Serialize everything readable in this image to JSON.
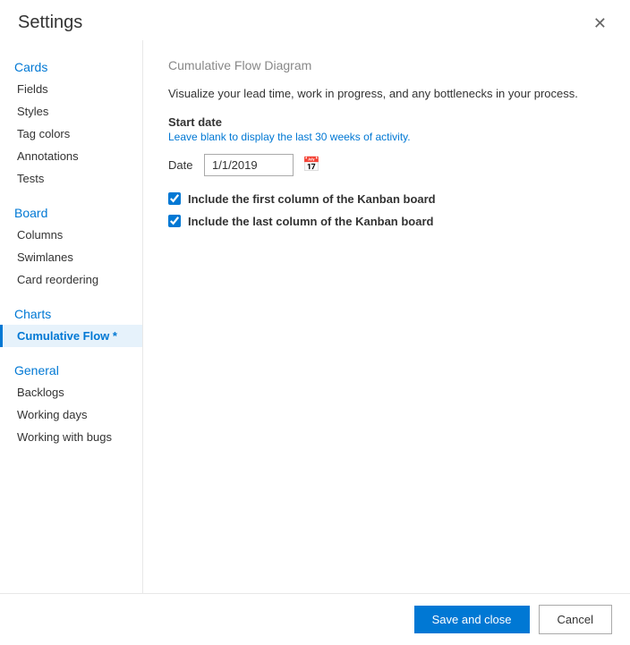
{
  "dialog": {
    "title": "Settings",
    "close_label": "✕"
  },
  "sidebar": {
    "sections": [
      {
        "header": "Cards",
        "header_key": "cards",
        "items": [
          {
            "label": "Fields",
            "key": "fields",
            "active": false
          },
          {
            "label": "Styles",
            "key": "styles",
            "active": false
          },
          {
            "label": "Tag colors",
            "key": "tag-colors",
            "active": false
          },
          {
            "label": "Annotations",
            "key": "annotations",
            "active": false
          },
          {
            "label": "Tests",
            "key": "tests",
            "active": false
          }
        ]
      },
      {
        "header": "Board",
        "header_key": "board",
        "items": [
          {
            "label": "Columns",
            "key": "columns",
            "active": false
          },
          {
            "label": "Swimlanes",
            "key": "swimlanes",
            "active": false
          },
          {
            "label": "Card reordering",
            "key": "card-reordering",
            "active": false
          }
        ]
      },
      {
        "header": "Charts",
        "header_key": "charts",
        "items": [
          {
            "label": "Cumulative Flow *",
            "key": "cumulative-flow",
            "active": true
          }
        ]
      },
      {
        "header": "General",
        "header_key": "general",
        "items": [
          {
            "label": "Backlogs",
            "key": "backlogs",
            "active": false
          },
          {
            "label": "Working days",
            "key": "working-days",
            "active": false
          },
          {
            "label": "Working with bugs",
            "key": "working-with-bugs",
            "active": false
          }
        ]
      }
    ]
  },
  "main": {
    "section_title": "Cumulative Flow Diagram",
    "description_part1": "Visualize your lead time, work in progress, and any bottlenecks in your process.",
    "start_date_label": "Start date",
    "start_date_hint": "Leave blank to display the last 30 weeks of activity.",
    "date_field_label": "Date",
    "date_value": "1/1/2019",
    "date_placeholder": "1/1/2019",
    "checkbox1_label": "Include the first column of the Kanban board",
    "checkbox2_label": "Include the last column of the Kanban board",
    "checkbox1_checked": true,
    "checkbox2_checked": true
  },
  "footer": {
    "save_label": "Save and close",
    "cancel_label": "Cancel"
  },
  "colors": {
    "accent": "#0078d4",
    "red": "#d83b01"
  }
}
